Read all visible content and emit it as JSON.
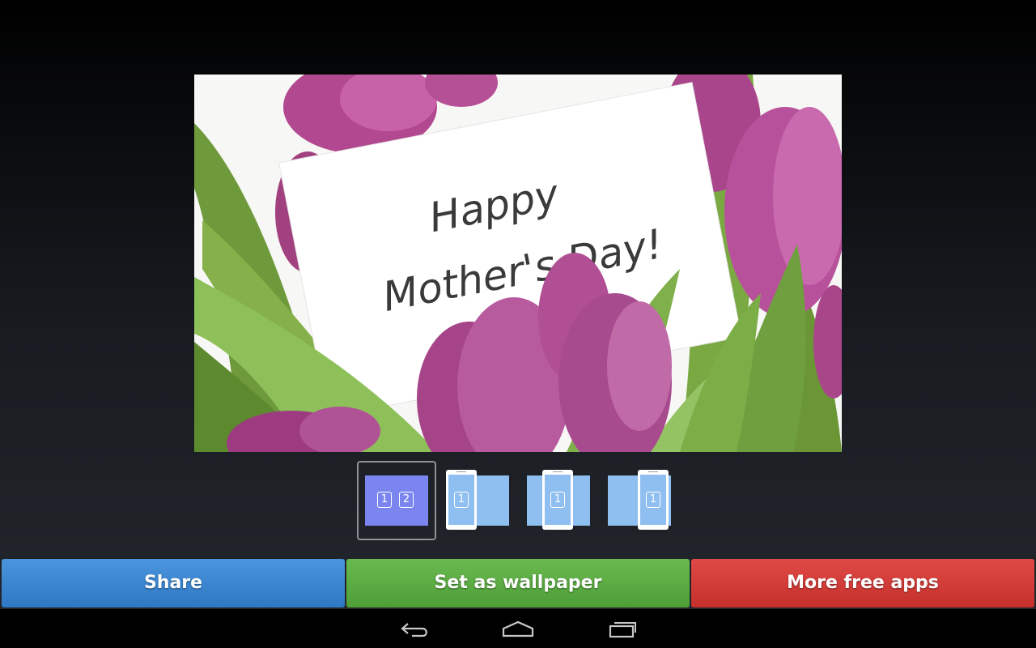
{
  "preview": {
    "card_line1": "Happy",
    "card_line2": "Mother's Day!"
  },
  "crop_options": [
    {
      "name": "crop-option-scrolling",
      "labels": [
        "1",
        "2"
      ],
      "selected": true
    },
    {
      "name": "crop-option-left",
      "labels": [
        "1"
      ],
      "selected": false
    },
    {
      "name": "crop-option-center",
      "labels": [
        "1"
      ],
      "selected": false
    },
    {
      "name": "crop-option-right",
      "labels": [
        "1"
      ],
      "selected": false
    }
  ],
  "buttons": {
    "share": "Share",
    "set_wallpaper": "Set as wallpaper",
    "more_apps": "More free apps"
  },
  "colors": {
    "share": "#3a86d0",
    "set_wallpaper": "#5bab44",
    "more_apps": "#d43d39",
    "crop_selected": "#7a85f0",
    "crop_other": "#8fbef0"
  },
  "nav": {
    "icons": [
      "back-icon",
      "home-icon",
      "recent-apps-icon"
    ]
  }
}
